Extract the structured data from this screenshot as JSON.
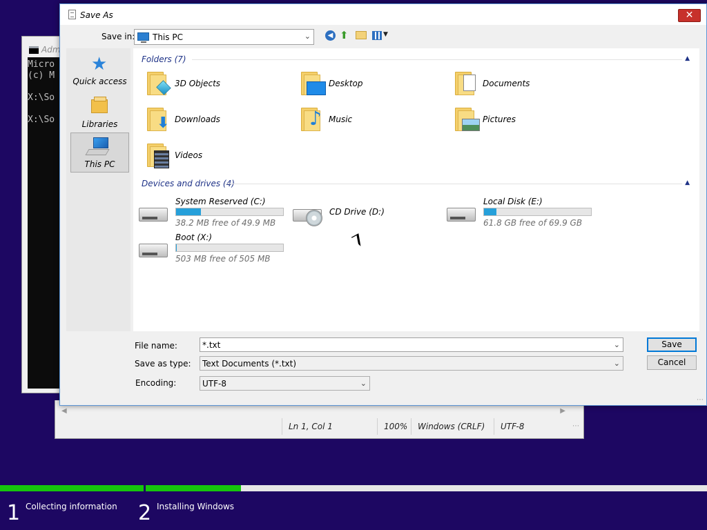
{
  "console": {
    "title": "Adm",
    "lines": [
      "Micro",
      "(c) M",
      "",
      "X:\\So",
      "",
      "X:\\So"
    ]
  },
  "notepad_status": {
    "position": "Ln 1, Col 1",
    "zoom": "100%",
    "line_endings": "Windows (CRLF)",
    "encoding": "UTF-8"
  },
  "dialog": {
    "title": "Save As",
    "close_glyph": "✕",
    "save_in_label": "Save in:",
    "save_in_value": "This PC",
    "places": [
      {
        "label": "Quick access",
        "icon": "star-icon"
      },
      {
        "label": "Libraries",
        "icon": "libraries-icon"
      },
      {
        "label": "This PC",
        "icon": "this-pc-icon",
        "selected": true
      }
    ],
    "folders_header": "Folders (7)",
    "folders": [
      {
        "label": "3D Objects",
        "icon": "3d-objects-icon"
      },
      {
        "label": "Desktop",
        "icon": "desktop-icon"
      },
      {
        "label": "Documents",
        "icon": "documents-icon"
      },
      {
        "label": "Downloads",
        "icon": "downloads-icon"
      },
      {
        "label": "Music",
        "icon": "music-icon"
      },
      {
        "label": "Pictures",
        "icon": "pictures-icon"
      },
      {
        "label": "Videos",
        "icon": "videos-icon"
      }
    ],
    "drives_header": "Devices and drives (4)",
    "drives": [
      {
        "label": "System Reserved (C:)",
        "free": "38.2 MB free of 49.9 MB",
        "used_fraction": 0.234,
        "type": "hdd"
      },
      {
        "label": "CD Drive (D:)",
        "type": "cd"
      },
      {
        "label": "Local Disk (E:)",
        "free": "61.8 GB free of 69.9 GB",
        "used_fraction": 0.116,
        "type": "hdd"
      },
      {
        "label": "Boot (X:)",
        "free": "503 MB free of 505 MB",
        "used_fraction": 0.004,
        "type": "hdd"
      }
    ],
    "file_name_label": "File name:",
    "file_name_value": "*.txt",
    "save_type_label": "Save as type:",
    "save_type_value": "Text Documents (*.txt)",
    "encoding_label": "Encoding:",
    "encoding_value": "UTF-8",
    "save_button": "Save",
    "cancel_button": "Cancel"
  },
  "setup": {
    "steps": [
      {
        "number": "1",
        "label": "Collecting information",
        "progress": 1.0
      },
      {
        "number": "2",
        "label": "Installing Windows",
        "progress": 0.17
      }
    ]
  },
  "colors": {
    "desktop_bg": "#1d0762",
    "progress_green": "#16c60c",
    "drive_bar_blue": "#26a0da",
    "group_header": "#1e3287",
    "close_red": "#c7312b"
  }
}
